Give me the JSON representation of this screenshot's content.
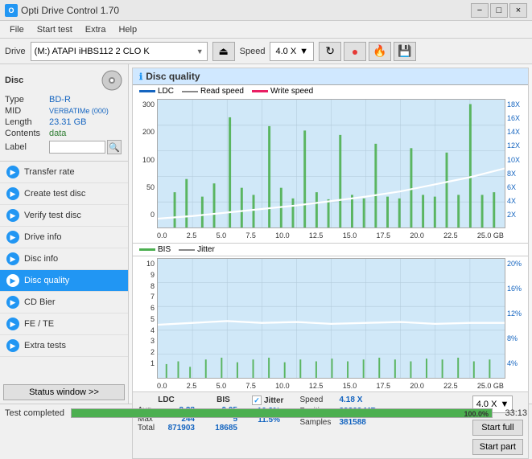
{
  "titlebar": {
    "title": "Opti Drive Control 1.70",
    "icon_label": "O",
    "minimize_label": "−",
    "maximize_label": "□",
    "close_label": "×"
  },
  "menubar": {
    "items": [
      "File",
      "Start test",
      "Extra",
      "Help"
    ]
  },
  "drivebar": {
    "label": "Drive",
    "drive_text": "(M:)  ATAPI iHBS112  2 CLO K",
    "speed_label": "Speed",
    "speed_value": "4.0 X"
  },
  "disc_panel": {
    "title": "Disc",
    "type_label": "Type",
    "type_value": "BD-R",
    "mid_label": "MID",
    "mid_value": "VERBATIMe (000)",
    "length_label": "Length",
    "length_value": "23.31 GB",
    "contents_label": "Contents",
    "contents_value": "data",
    "label_label": "Label"
  },
  "sidebar": {
    "items": [
      {
        "id": "transfer-rate",
        "label": "Transfer rate",
        "active": false
      },
      {
        "id": "create-test-disc",
        "label": "Create test disc",
        "active": false
      },
      {
        "id": "verify-test-disc",
        "label": "Verify test disc",
        "active": false
      },
      {
        "id": "drive-info",
        "label": "Drive info",
        "active": false
      },
      {
        "id": "disc-info",
        "label": "Disc info",
        "active": false
      },
      {
        "id": "disc-quality",
        "label": "Disc quality",
        "active": true
      },
      {
        "id": "cd-bier",
        "label": "CD Bier",
        "active": false
      },
      {
        "id": "fe-te",
        "label": "FE / TE",
        "active": false
      },
      {
        "id": "extra-tests",
        "label": "Extra tests",
        "active": false
      }
    ],
    "status_button": "Status window >>"
  },
  "chart": {
    "title": "Disc quality",
    "top_legend": {
      "ldc_label": "LDC",
      "read_label": "Read speed",
      "write_label": "Write speed"
    },
    "top_y_left": [
      "300",
      "200",
      "100",
      "50",
      "0"
    ],
    "top_y_right": [
      "18X",
      "16X",
      "14X",
      "12X",
      "10X",
      "8X",
      "6X",
      "4X",
      "2X"
    ],
    "bottom_legend": {
      "bis_label": "BIS",
      "jitter_label": "Jitter"
    },
    "bottom_y_left": [
      "10",
      "9",
      "8",
      "7",
      "6",
      "5",
      "4",
      "3",
      "2",
      "1"
    ],
    "bottom_y_right": [
      "20%",
      "16%",
      "12%",
      "8%",
      "4%"
    ],
    "x_axis": [
      "0.0",
      "2.5",
      "5.0",
      "7.5",
      "10.0",
      "12.5",
      "15.0",
      "17.5",
      "20.0",
      "22.5",
      "25.0 GB"
    ]
  },
  "stats": {
    "ldc_header": "LDC",
    "bis_header": "BIS",
    "jitter_header": "Jitter",
    "avg_label": "Avg",
    "max_label": "Max",
    "total_label": "Total",
    "ldc_avg": "2.28",
    "ldc_max": "244",
    "ldc_total": "871903",
    "bis_avg": "0.05",
    "bis_max": "5",
    "bis_total": "18685",
    "jitter_avg": "10.3%",
    "jitter_max": "11.5%",
    "speed_label": "Speed",
    "speed_value": "4.18 X",
    "position_label": "Position",
    "position_value": "23862 MB",
    "samples_label": "Samples",
    "samples_value": "381588",
    "speed_select": "4.0 X"
  },
  "buttons": {
    "start_full": "Start full",
    "start_part": "Start part"
  },
  "statusbar": {
    "status_text": "Test completed",
    "progress": "100.0%",
    "time": "33:13"
  }
}
